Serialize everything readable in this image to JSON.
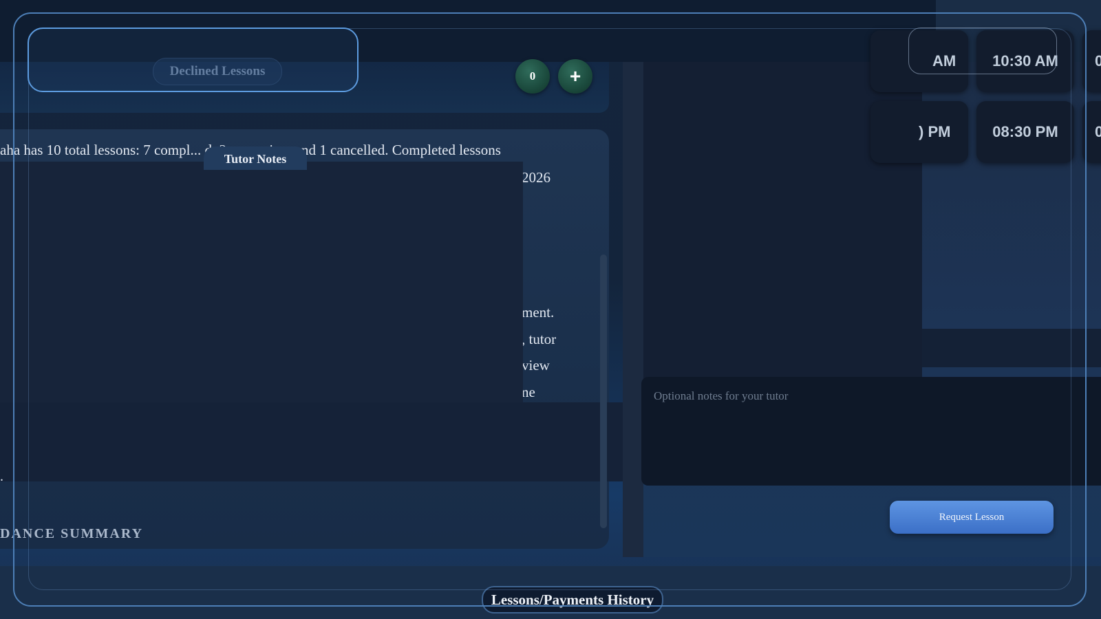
{
  "lessons_panel": {
    "declined_tab_label": "Declined Lessons",
    "declined_count": "0",
    "add_icon_glyph": "+",
    "summary_line": "aha has 10 total lessons: 7 compl... d, 2 upcoming, and 1 cancelled. Completed lessons",
    "right_fragments": [
      "2026",
      "ment.",
      ", tutor",
      "view",
      "ne"
    ],
    "dot": ".",
    "tutor_notes_tab": "Tutor Notes",
    "attendance_heading": "DANCE SUMMARY"
  },
  "booking_panel": {
    "time_slots": [
      {
        "label": "AM"
      },
      {
        "label": "10:30 AM"
      },
      {
        "label": "0"
      },
      {
        "label": ") PM"
      },
      {
        "label": "08:30 PM"
      },
      {
        "label": "0"
      }
    ],
    "notes_placeholder": "Optional notes for your tutor",
    "request_button": "Request Lesson"
  },
  "footer": {
    "history_tab": "Lessons/Payments History"
  },
  "colors": {
    "accent": "#4d7fb7",
    "button_blue": "#4a82d6",
    "green_badge": "#1b4a3d"
  }
}
